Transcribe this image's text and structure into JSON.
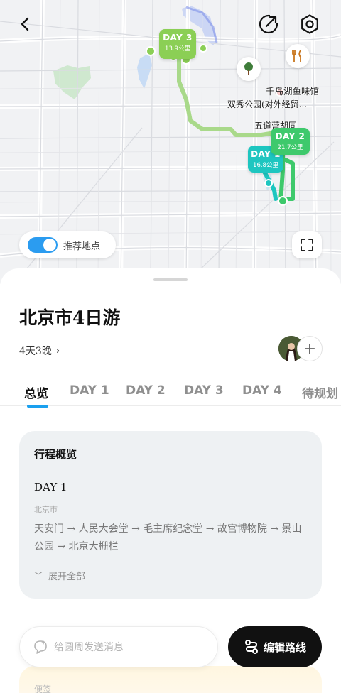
{
  "map": {
    "labels": [
      "千岛湖鱼味馆",
      "双秀公园(对外经贸...",
      "五道营胡同"
    ],
    "day_markers": [
      {
        "title": "DAY 3",
        "distance": "13.9公里"
      },
      {
        "title": "DAY 2",
        "distance": "21.7公里"
      },
      {
        "title": "DAY 1",
        "distance": "16.8公里"
      }
    ],
    "toggle": {
      "label": "推荐地点",
      "on": true
    },
    "route_colors": {
      "day1": "#1ec6c0",
      "day2": "#3ec96c",
      "day3": "#8bcf55"
    }
  },
  "trip": {
    "title": "北京市4日游",
    "duration": "4天3晚"
  },
  "tabs": [
    "总览",
    "DAY 1",
    "DAY 2",
    "DAY 3",
    "DAY 4",
    "待规划"
  ],
  "active_tab": "总览",
  "overview": {
    "title": "行程概览",
    "day": "DAY 1",
    "city": "北京市",
    "route": "天安门 → 人民大会堂 → 毛主席纪念堂 → 故宫博物院 → 景山公园 → 北京大栅栏",
    "expand_label": "展开全部"
  },
  "tips": {
    "label": "便签"
  },
  "message_input": {
    "placeholder": "给圆周发送消息"
  },
  "edit_route": {
    "label": "编辑路线"
  },
  "colors": {
    "accent": "#1aa0ef",
    "toggle": "#2b9cf0"
  }
}
